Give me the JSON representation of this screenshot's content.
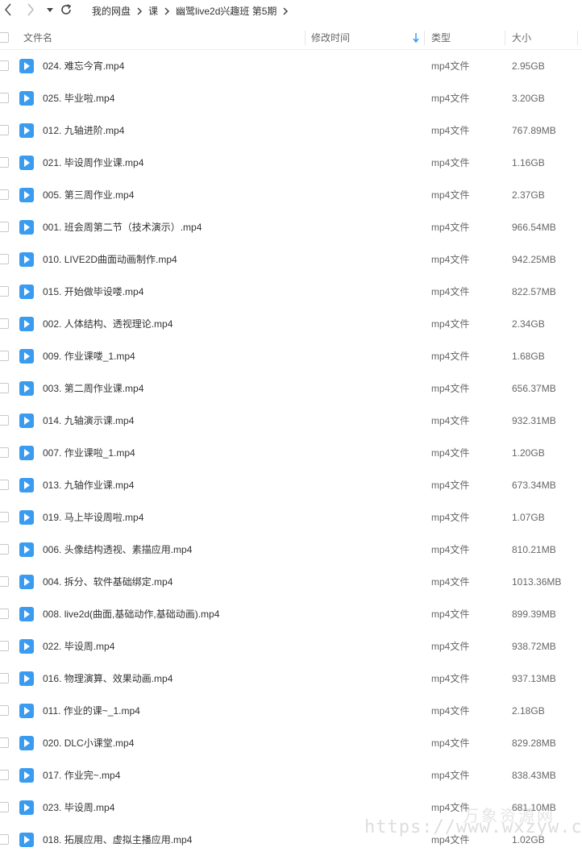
{
  "breadcrumb": [
    "我的网盘",
    "课",
    "幽鹭live2d兴趣班 第5期"
  ],
  "columns": {
    "name": "文件名",
    "modified": "修改时间",
    "type": "类型",
    "size": "大小"
  },
  "files": [
    {
      "name": "024.  难忘今宵.mp4",
      "type": "mp4文件",
      "size": "2.95GB"
    },
    {
      "name": "025.  毕业啦.mp4",
      "type": "mp4文件",
      "size": "3.20GB"
    },
    {
      "name": "012.  九轴进阶.mp4",
      "type": "mp4文件",
      "size": "767.89MB"
    },
    {
      "name": "021.  毕设周作业课.mp4",
      "type": "mp4文件",
      "size": "1.16GB"
    },
    {
      "name": "005.  第三周作业.mp4",
      "type": "mp4文件",
      "size": "2.37GB"
    },
    {
      "name": "001.  班会周第二节（技术演示）.mp4",
      "type": "mp4文件",
      "size": "966.54MB"
    },
    {
      "name": "010.  LIVE2D曲面动画制作.mp4",
      "type": "mp4文件",
      "size": "942.25MB"
    },
    {
      "name": "015.  开始做毕设喽.mp4",
      "type": "mp4文件",
      "size": "822.57MB"
    },
    {
      "name": "002.  人体结构、透视理论.mp4",
      "type": "mp4文件",
      "size": "2.34GB"
    },
    {
      "name": "009.  作业课喽_1.mp4",
      "type": "mp4文件",
      "size": "1.68GB"
    },
    {
      "name": "003.  第二周作业课.mp4",
      "type": "mp4文件",
      "size": "656.37MB"
    },
    {
      "name": "014.  九轴演示课.mp4",
      "type": "mp4文件",
      "size": "932.31MB"
    },
    {
      "name": "007.  作业课啦_1.mp4",
      "type": "mp4文件",
      "size": "1.20GB"
    },
    {
      "name": "013.  九轴作业课.mp4",
      "type": "mp4文件",
      "size": "673.34MB"
    },
    {
      "name": "019.  马上毕设周啦.mp4",
      "type": "mp4文件",
      "size": "1.07GB"
    },
    {
      "name": "006.  头像结构透视、素描应用.mp4",
      "type": "mp4文件",
      "size": "810.21MB"
    },
    {
      "name": "004.  拆分、软件基础绑定.mp4",
      "type": "mp4文件",
      "size": "1013.36MB"
    },
    {
      "name": "008.  live2d(曲面,基础动作,基础动画).mp4",
      "type": "mp4文件",
      "size": "899.39MB"
    },
    {
      "name": "022.  毕设周.mp4",
      "type": "mp4文件",
      "size": "938.72MB"
    },
    {
      "name": "016.  物理演算、效果动画.mp4",
      "type": "mp4文件",
      "size": "937.13MB"
    },
    {
      "name": "011.  作业的课~_1.mp4",
      "type": "mp4文件",
      "size": "2.18GB"
    },
    {
      "name": "020.  DLC小课堂.mp4",
      "type": "mp4文件",
      "size": "829.28MB"
    },
    {
      "name": "017.  作业完~.mp4",
      "type": "mp4文件",
      "size": "838.43MB"
    },
    {
      "name": "023.  毕设周.mp4",
      "type": "mp4文件",
      "size": "681.10MB"
    },
    {
      "name": "018.  拓展应用、虚拟主播应用.mp4",
      "type": "mp4文件",
      "size": "1.02GB"
    }
  ],
  "watermark": {
    "text": "https://www.wxzyw.cn",
    "text_cn": "万象资源网"
  },
  "colors": {
    "accent": "#3a9cf0",
    "sort_arrow": "#3a9cf0"
  }
}
